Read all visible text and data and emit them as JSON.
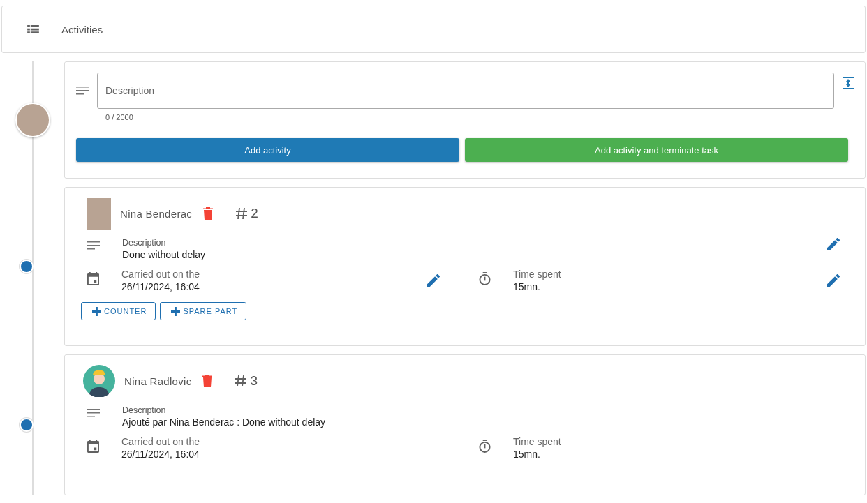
{
  "header": {
    "title": "Activities"
  },
  "composer": {
    "placeholder": "Description",
    "counter": "0 / 2000",
    "buttons": [
      {
        "label": "Add activity",
        "kind": "primary"
      },
      {
        "label": "Add activity and terminate task",
        "kind": "success"
      }
    ]
  },
  "activities": [
    {
      "author": "Nina Benderac",
      "kind": "photo",
      "number": "2",
      "description_label": "Description",
      "description": "Done without delay",
      "date_label": "Carried out on the",
      "date": "26/11/2024, 16:04",
      "time_label": "Time spent",
      "time": "15mn.",
      "editable": true,
      "actions": [
        {
          "label": "COUNTER"
        },
        {
          "label": "SPARE PART"
        }
      ]
    },
    {
      "author": "Nina Radlovic",
      "kind": "illustration",
      "number": "3",
      "description_label": "Description",
      "description": "Ajouté par Nina Benderac : Done without delay",
      "date_label": "Carried out on the",
      "date": "26/11/2024, 16:04",
      "time_label": "Time spent",
      "time": "15mn.",
      "editable": false
    }
  ]
}
